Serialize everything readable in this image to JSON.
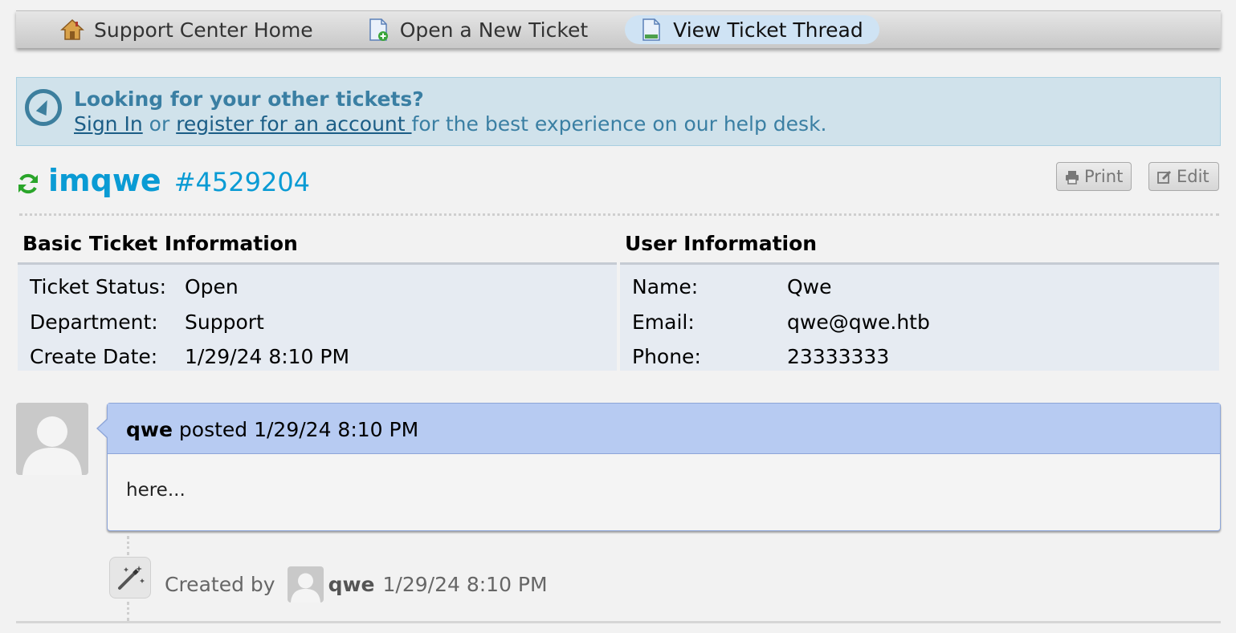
{
  "nav": {
    "items": [
      {
        "label": "Support Center Home",
        "icon": "home-icon"
      },
      {
        "label": "Open a New Ticket",
        "icon": "new-ticket-icon"
      },
      {
        "label": "View Ticket Thread",
        "icon": "ticket-thread-icon",
        "active": true
      }
    ]
  },
  "notice": {
    "heading": "Looking for your other tickets?",
    "sign_in": "Sign In",
    "or": "or",
    "register": "register for an account ",
    "suffix": "for the best experience on our help desk.",
    "icon": "compass-icon"
  },
  "ticket": {
    "subject": "imqwe",
    "number": "#4529204",
    "status_icon": "refresh-icon",
    "print_label": "Print",
    "edit_label": "Edit"
  },
  "basic_info": {
    "heading": "Basic Ticket Information",
    "rows": [
      {
        "label": "Ticket Status:",
        "value": "Open"
      },
      {
        "label": "Department:",
        "value": "Support"
      },
      {
        "label": "Create Date:",
        "value": "1/29/24 8:10 PM"
      }
    ]
  },
  "user_info": {
    "heading": "User Information",
    "rows": [
      {
        "label": "Name:",
        "value": "Qwe"
      },
      {
        "label": "Email:",
        "value": "qwe@qwe.htb"
      },
      {
        "label": "Phone:",
        "value": "23333333"
      }
    ]
  },
  "thread": {
    "entry": {
      "author": "qwe",
      "posted": "posted 1/29/24 8:10 PM",
      "body": "here..."
    },
    "event": {
      "created_by": "Created by",
      "user": "qwe",
      "time": "1/29/24 8:10 PM",
      "icon": "magic-wand-icon"
    }
  },
  "colors": {
    "accent": "#0a9bd4",
    "notice_bg": "#d0e2eb",
    "entry_header": "#b7cbf2",
    "status_green": "#2aa52a"
  }
}
